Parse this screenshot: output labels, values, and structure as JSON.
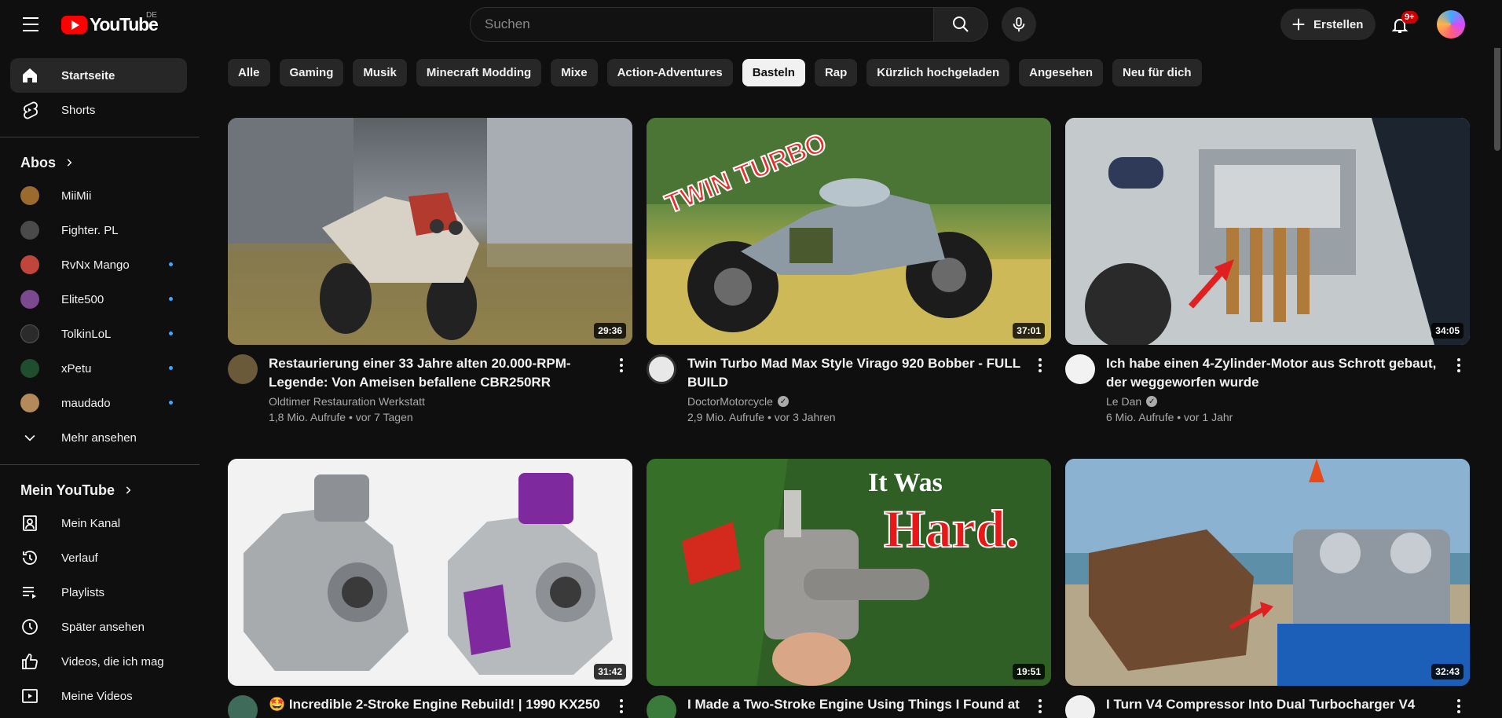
{
  "header": {
    "logo_text": "YouTube",
    "logo_region": "DE",
    "search_placeholder": "Suchen",
    "create_label": "Erstellen",
    "notification_badge": "9+"
  },
  "sidebar": {
    "main": [
      {
        "label": "Startseite",
        "icon": "home-icon",
        "active": true
      },
      {
        "label": "Shorts",
        "icon": "shorts-icon"
      }
    ],
    "subs_heading": "Abos",
    "subs": [
      {
        "label": "MiiMii",
        "color": "#9b6a2e",
        "live": false
      },
      {
        "label": "Fighter. PL",
        "color": "#4a4a4a",
        "live": false
      },
      {
        "label": "RvNx Mango",
        "color": "#c0463b",
        "live": true
      },
      {
        "label": "Elite500",
        "color": "#7b4a8e",
        "live": true
      },
      {
        "label": "TolkinLoL",
        "color": "#2b2b2b",
        "live": true
      },
      {
        "label": "xPetu",
        "color": "#1f4d2e",
        "live": true
      },
      {
        "label": "maudado",
        "color": "#b58a5a",
        "live": true
      }
    ],
    "show_more": "Mehr ansehen",
    "you_heading": "Mein YouTube",
    "you": [
      {
        "label": "Mein Kanal",
        "icon": "channel-icon"
      },
      {
        "label": "Verlauf",
        "icon": "history-icon"
      },
      {
        "label": "Playlists",
        "icon": "playlists-icon"
      },
      {
        "label": "Später ansehen",
        "icon": "watch-later-icon"
      },
      {
        "label": "Videos, die ich mag",
        "icon": "like-icon"
      },
      {
        "label": "Meine Videos",
        "icon": "my-videos-icon"
      }
    ]
  },
  "chips": [
    "Alle",
    "Gaming",
    "Musik",
    "Minecraft Modding",
    "Mixe",
    "Action-Adventures",
    "Basteln",
    "Rap",
    "Kürzlich hochgeladen",
    "Angesehen",
    "Neu für dich"
  ],
  "active_chip": "Basteln",
  "videos": [
    {
      "title": "Restaurierung einer 33 Jahre alten 20.000-RPM-Legende: Von Ameisen befallene CBR250RR",
      "channel": "Oldtimer Restauration Werkstatt",
      "verified": false,
      "stats": "1,8 Mio. Aufrufe • vor 7 Tagen",
      "duration": "29:36",
      "avatar_color": "#6b5a3a"
    },
    {
      "title": "Twin Turbo Mad Max Style Virago 920 Bobber - FULL BUILD",
      "channel": "DoctorMotorcycle",
      "verified": true,
      "stats": "2,9 Mio. Aufrufe • vor 3 Jahren",
      "duration": "37:01",
      "avatar_color": "#e8e8e8"
    },
    {
      "title": "Ich habe einen 4-Zylinder-Motor aus Schrott gebaut, der weggeworfen wurde",
      "channel": "Le Dan",
      "verified": true,
      "stats": "6 Mio. Aufrufe • vor 1 Jahr",
      "duration": "34:05",
      "avatar_color": "#f2f2f2"
    },
    {
      "title": "🤩 Incredible 2-Stroke Engine Rebuild! | 1990 KX250",
      "channel": "",
      "verified": false,
      "stats": "",
      "duration": "31:42",
      "avatar_color": "#3e6b5a"
    },
    {
      "title": "I Made a Two-Stroke Engine Using Things I Found at",
      "channel": "",
      "verified": false,
      "stats": "",
      "duration": "19:51",
      "avatar_color": "#3a7a3a"
    },
    {
      "title": "I Turn V4 Compressor Into Dual Turbocharger V4",
      "channel": "",
      "verified": false,
      "stats": "",
      "duration": "32:43",
      "avatar_color": "#f0f0f0"
    }
  ],
  "thumb_overlays": {
    "twin_turbo": "TWIN TURBO",
    "it_was": "It Was",
    "hard": "Hard."
  }
}
